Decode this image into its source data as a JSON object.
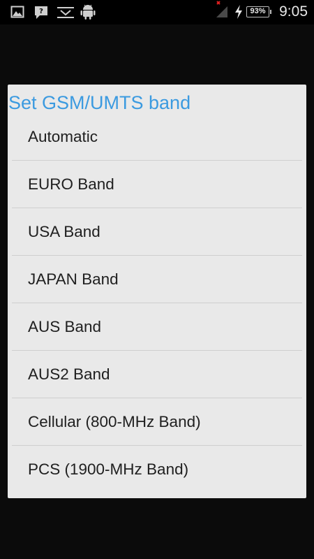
{
  "status_bar": {
    "time": "9:05",
    "battery_percent": "93%",
    "icons": [
      "image-icon",
      "chat-icon",
      "usb-icon",
      "android-icon",
      "signal-no-sim-icon",
      "charging-icon",
      "battery-icon"
    ]
  },
  "dialog": {
    "title": "Set GSM/UMTS band",
    "accent_color": "#3b9ae0",
    "options": [
      {
        "label": "Automatic"
      },
      {
        "label": "EURO Band"
      },
      {
        "label": "USA Band"
      },
      {
        "label": "JAPAN Band"
      },
      {
        "label": "AUS Band"
      },
      {
        "label": "AUS2 Band"
      },
      {
        "label": "Cellular (800-MHz Band)"
      },
      {
        "label": "PCS (1900-MHz Band)"
      }
    ]
  }
}
